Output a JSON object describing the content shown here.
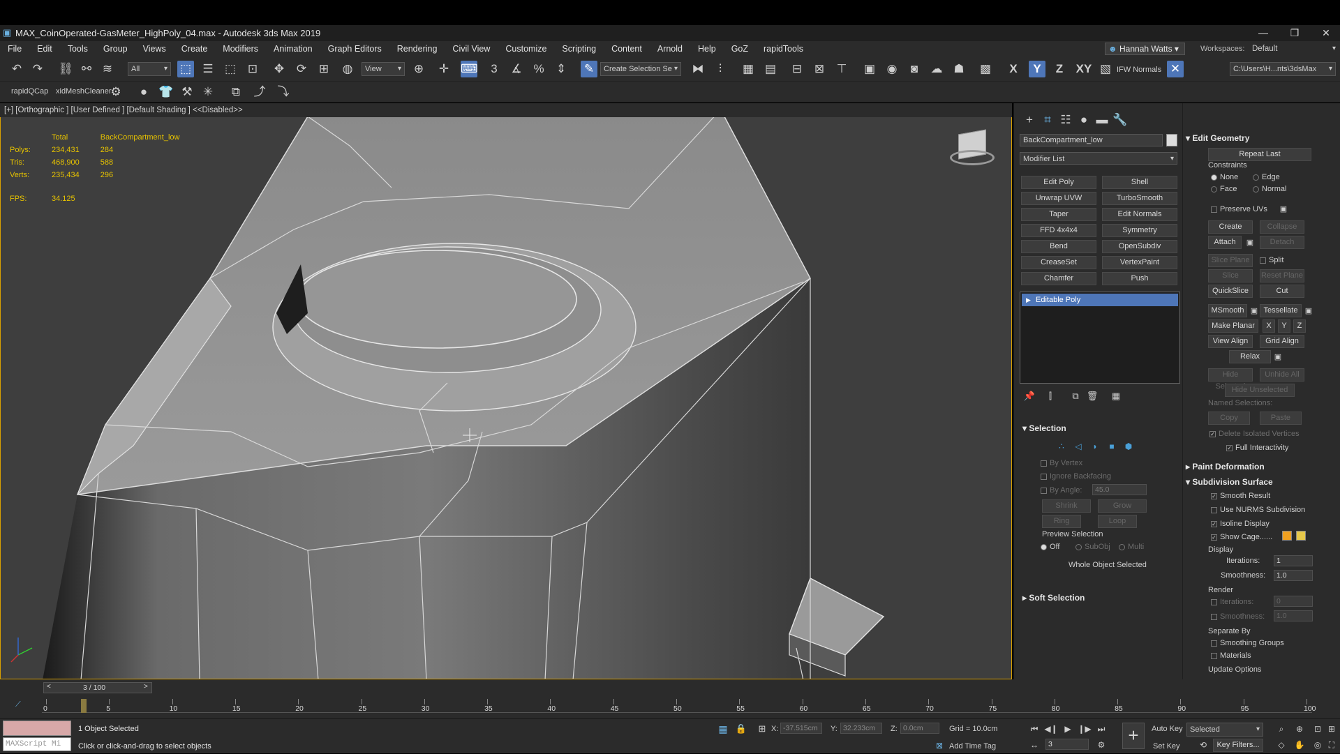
{
  "window": {
    "title": "MAX_CoinOperated-GasMeter_HighPoly_04.max - Autodesk 3ds Max 2019"
  },
  "menu": [
    "File",
    "Edit",
    "Tools",
    "Group",
    "Views",
    "Create",
    "Modifiers",
    "Animation",
    "Graph Editors",
    "Rendering",
    "Civil View",
    "Customize",
    "Scripting",
    "Content",
    "Arnold",
    "Help",
    "GoZ",
    "rapidTools"
  ],
  "user": {
    "name": "Hannah Watts"
  },
  "workspaces": {
    "label": "Workspaces:",
    "value": "Default"
  },
  "toolbar": {
    "filter": "All",
    "ref_coord": "View",
    "create_selection_set": "Create Selection Se",
    "axis_x": "X",
    "axis_y": "Y",
    "axis_z": "Z",
    "axis_xy": "XY",
    "ifw_normals": "IFW Normals",
    "project_path": "C:\\Users\\H...nts\\3dsMax"
  },
  "toolbar2": {
    "rapid_qcap": "rapidQCap",
    "xid_mesh_clean": "xidMeshCleaner"
  },
  "viewport": {
    "label": "[+] [Orthographic ] [User Defined ] [Default Shading ]  <<Disabled>>",
    "stats": {
      "total_label": "Total",
      "object_label": "BackCompartment_low",
      "rows": [
        {
          "name": "Polys:",
          "total": "234,431",
          "obj": "284"
        },
        {
          "name": "Tris:",
          "total": "468,900",
          "obj": "588"
        },
        {
          "name": "Verts:",
          "total": "235,434",
          "obj": "296"
        }
      ],
      "fps_label": "FPS:",
      "fps": "34.125"
    }
  },
  "command_panel": {
    "object_name": "BackCompartment_low",
    "modifier_list": "Modifier List",
    "modifier_buttons": [
      "Edit Poly",
      "Shell",
      "Unwrap UVW",
      "TurboSmooth",
      "Taper",
      "Edit Normals",
      "FFD 4x4x4",
      "Symmetry",
      "Bend",
      "OpenSubdiv",
      "CreaseSet",
      "VertexPaint",
      "Chamfer",
      "Push"
    ],
    "stack_item": "Editable Poly",
    "selection": {
      "title": "Selection",
      "by_vertex": "By Vertex",
      "ignore_backfacing": "Ignore Backfacing",
      "by_angle": "By Angle:",
      "by_angle_value": "45.0",
      "shrink": "Shrink",
      "grow": "Grow",
      "ring": "Ring",
      "loop": "Loop",
      "preview_selection": "Preview Selection",
      "off": "Off",
      "subobj": "SubObj",
      "multi": "Multi",
      "status": "Whole Object Selected"
    },
    "soft_selection": "Soft Selection"
  },
  "edit_geometry": {
    "title": "Edit Geometry",
    "repeat_last": "Repeat Last",
    "constraints": "Constraints",
    "none": "None",
    "edge": "Edge",
    "face": "Face",
    "normal": "Normal",
    "preserve_uvs": "Preserve UVs",
    "create": "Create",
    "collapse": "Collapse",
    "attach": "Attach",
    "detach": "Detach",
    "slice_plane": "Slice Plane",
    "split": "Split",
    "slice": "Slice",
    "reset_plane": "Reset Plane",
    "quickslice": "QuickSlice",
    "cut": "Cut",
    "msmooth": "MSmooth",
    "tessellate": "Tessellate",
    "make_planar": "Make Planar",
    "x": "X",
    "y": "Y",
    "z": "Z",
    "view_align": "View Align",
    "grid_align": "Grid Align",
    "relax": "Relax",
    "hide_selected": "Hide Selected",
    "unhide_all": "Unhide All",
    "hide_unselected": "Hide Unselected",
    "named_selections": "Named Selections:",
    "copy": "Copy",
    "paste": "Paste",
    "delete_isolated": "Delete Isolated Vertices",
    "full_interactivity": "Full Interactivity"
  },
  "paint_deformation": "Paint Deformation",
  "subdivision_surface": {
    "title": "Subdivision Surface",
    "smooth_result": "Smooth Result",
    "use_nurms": "Use NURMS Subdivision",
    "isoline_display": "Isoline Display",
    "show_cage": "Show Cage......",
    "cage_color1": "#f0a020",
    "cage_color2": "#e6c84a",
    "display": "Display",
    "iterations_label": "Iterations:",
    "iterations_value": "1",
    "smoothness_label": "Smoothness:",
    "smoothness_value": "1.0",
    "render": "Render",
    "render_iterations": "0",
    "render_smoothness": "1.0",
    "separate_by": "Separate By",
    "smoothing_groups": "Smoothing Groups",
    "materials": "Materials",
    "update_options": "Update Options"
  },
  "timeline": {
    "frame": "3 / 100",
    "ticks": [
      "0",
      "5",
      "10",
      "15",
      "20",
      "25",
      "30",
      "35",
      "40",
      "45",
      "50",
      "55",
      "60",
      "65",
      "70",
      "75",
      "80",
      "85",
      "90",
      "95",
      "100"
    ]
  },
  "status": {
    "maxscript": "MAXScript Mi",
    "selected": "1 Object Selected",
    "prompt": "Click or click-and-drag to select objects",
    "x_label": "X:",
    "x": "-37.515cm",
    "y_label": "Y:",
    "y": "32.233cm",
    "z_label": "Z:",
    "z": "0.0cm",
    "grid": "Grid = 10.0cm",
    "add_time_tag": "Add Time Tag",
    "frame_value": "3",
    "auto_key": "Auto Key",
    "set_key": "Set Key",
    "key_mode": "Selected",
    "key_filters": "Key Filters..."
  }
}
